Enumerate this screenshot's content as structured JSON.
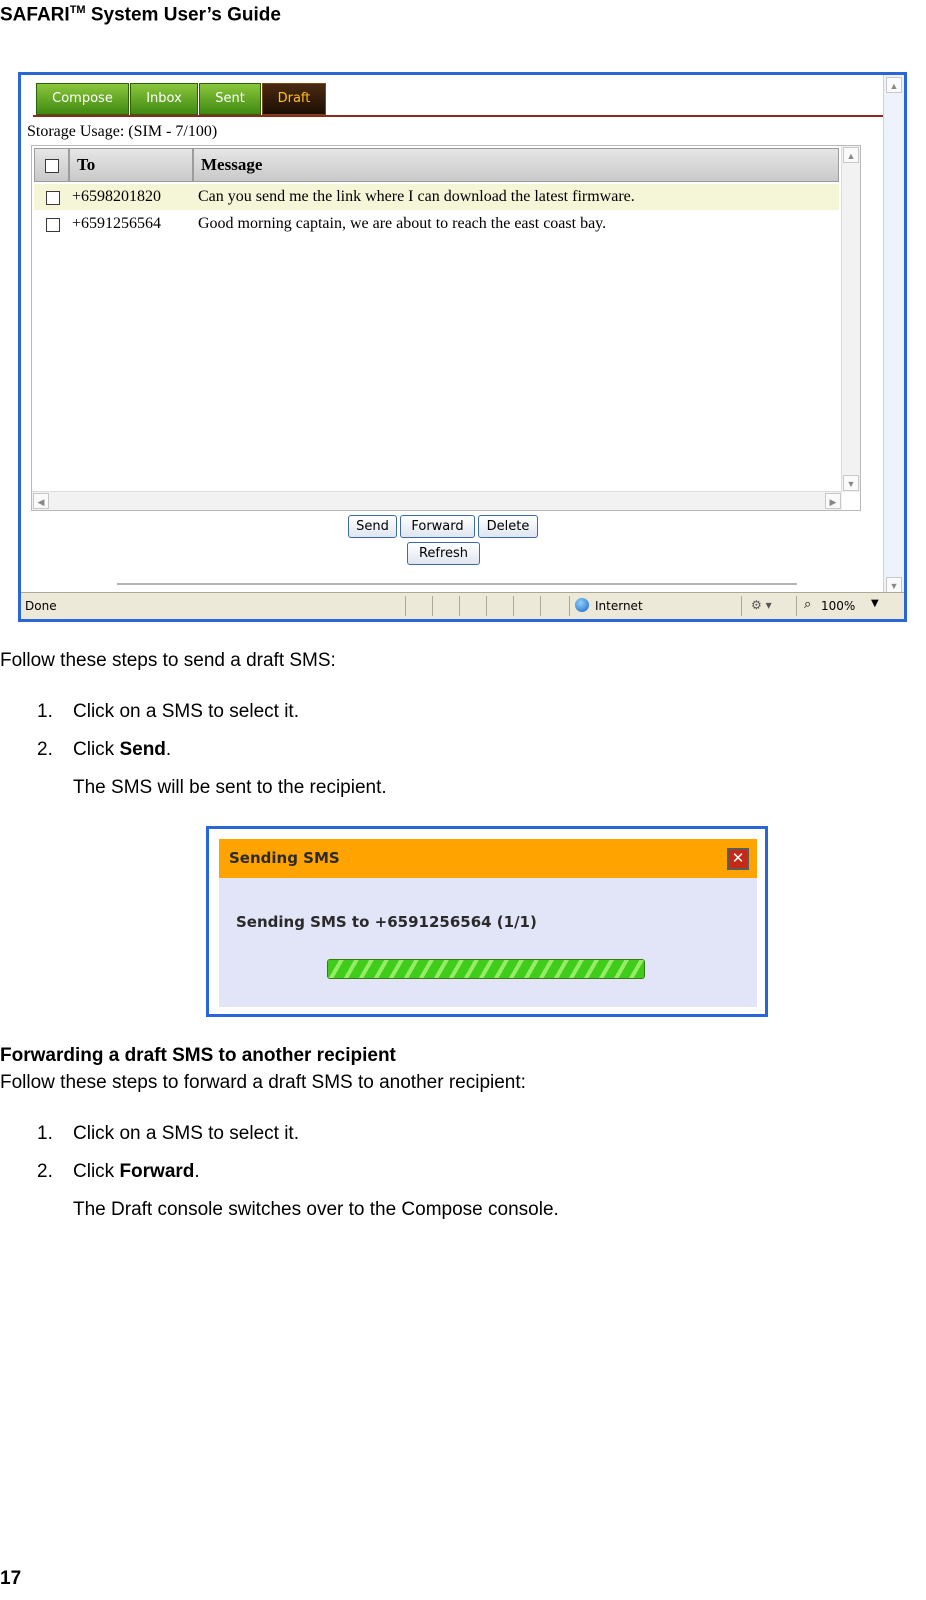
{
  "header": {
    "title_prefix": "SAFARI",
    "tm": "TM",
    "title_suffix": " System User’s Guide"
  },
  "page_number": "17",
  "screenshot1": {
    "tabs": [
      {
        "label": "Compose",
        "active": false
      },
      {
        "label": "Inbox",
        "active": false
      },
      {
        "label": "Sent",
        "active": false
      },
      {
        "label": "Draft",
        "active": true
      }
    ],
    "storage_usage": "Storage Usage: (SIM - 7/100)",
    "columns": [
      "To",
      "Message"
    ],
    "rows": [
      {
        "to": "+6598201820",
        "message": "Can you send me the link where I can download the latest firmware.",
        "checked": false,
        "selected": true
      },
      {
        "to": "+6591256564",
        "message": "Good morning captain, we are about to reach the east coast bay.",
        "checked": false,
        "selected": false
      }
    ],
    "buttons": {
      "send": "Send",
      "forward": "Forward",
      "delete": "Delete",
      "refresh": "Refresh"
    },
    "statusbar": {
      "status": "Done",
      "zone": "Internet",
      "zoom": "100%"
    }
  },
  "section1": {
    "intro": "Follow these steps to send a draft SMS:",
    "step1_num": "1.",
    "step1": "Click on a SMS to select it.",
    "step2_num": "2.",
    "step2_prefix": "Click ",
    "step2_bold": "Send",
    "step2_suffix": ".",
    "result": "The SMS will be sent to the recipient."
  },
  "dialog": {
    "title": "Sending SMS",
    "close_glyph": "✕",
    "message": "Sending SMS to +6591256564 (1/1)",
    "progress": 1.0
  },
  "section2": {
    "heading": "Forwarding a draft SMS to another recipient",
    "intro": "Follow these steps to forward a draft SMS to another recipient:",
    "step1_num": "1.",
    "step1": "Click on a SMS to select it.",
    "step2_num": "2.",
    "step2_prefix": "Click ",
    "step2_bold": "Forward",
    "step2_suffix": ".",
    "result": "The Draft console switches over to the Compose console."
  },
  "icons": {
    "globe": "globe-icon",
    "zoom": "magnifier-icon",
    "close": "close-icon"
  }
}
